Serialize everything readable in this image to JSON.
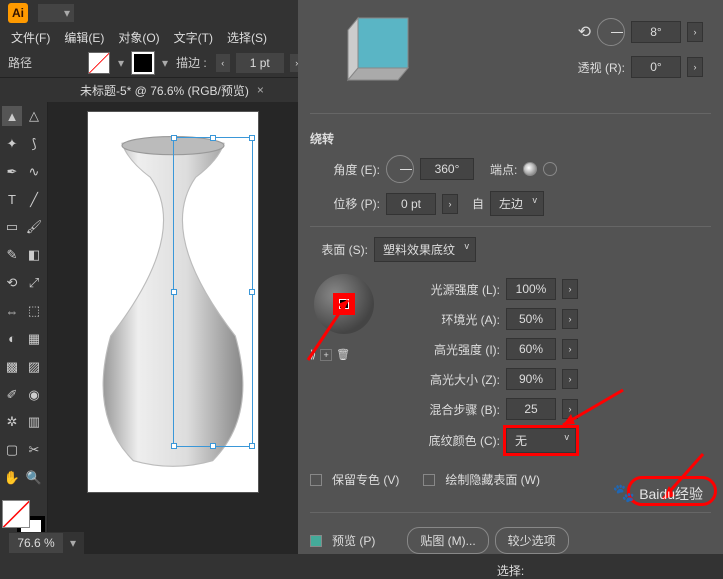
{
  "top": {
    "logo": "Ai"
  },
  "menu": {
    "file": "文件(F)",
    "edit": "编辑(E)",
    "object": "对象(O)",
    "type": "文字(T)",
    "select": "选择(S)"
  },
  "control": {
    "path_label": "路径",
    "stroke_label": "描边 :",
    "stroke_width": "1 pt"
  },
  "doc": {
    "tab": "未标题-5* @ 76.6% (RGB/预览)",
    "close": "×"
  },
  "panel": {
    "angle_top": "8°",
    "perspective_label": "透视 (R):",
    "perspective_val": "0°",
    "revolve_title": "绕转",
    "angle_label": "角度 (E):",
    "angle_val": "360°",
    "cap_label": "端点:",
    "offset_label": "位移 (P):",
    "offset_val": "0 pt",
    "from_label": "自",
    "from_val": "左边",
    "surface_label": "表面 (S):",
    "surface_val": "塑料效果底纹",
    "light_intensity_label": "光源强度 (L):",
    "light_intensity_val": "100%",
    "ambient_label": "环境光 (A):",
    "ambient_val": "50%",
    "highlight_intensity_label": "高光强度 (I):",
    "highlight_intensity_val": "60%",
    "highlight_size_label": "高光大小 (Z):",
    "highlight_size_val": "90%",
    "blend_steps_label": "混合步骤 (B):",
    "blend_steps_val": "25",
    "shade_color_label": "底纹颜色 (C):",
    "shade_color_val": "无",
    "preserve_spot_label": "保留专色 (V)",
    "draw_hidden_label": "绘制隐藏表面 (W)",
    "preview_label": "预览 (P)",
    "map_art_btn": "贴图 (M)...",
    "fewer_btn": "较少选项",
    "select_label": "选择:"
  },
  "status": {
    "zoom": "76.6 %"
  },
  "watermark": "Baidu经验"
}
